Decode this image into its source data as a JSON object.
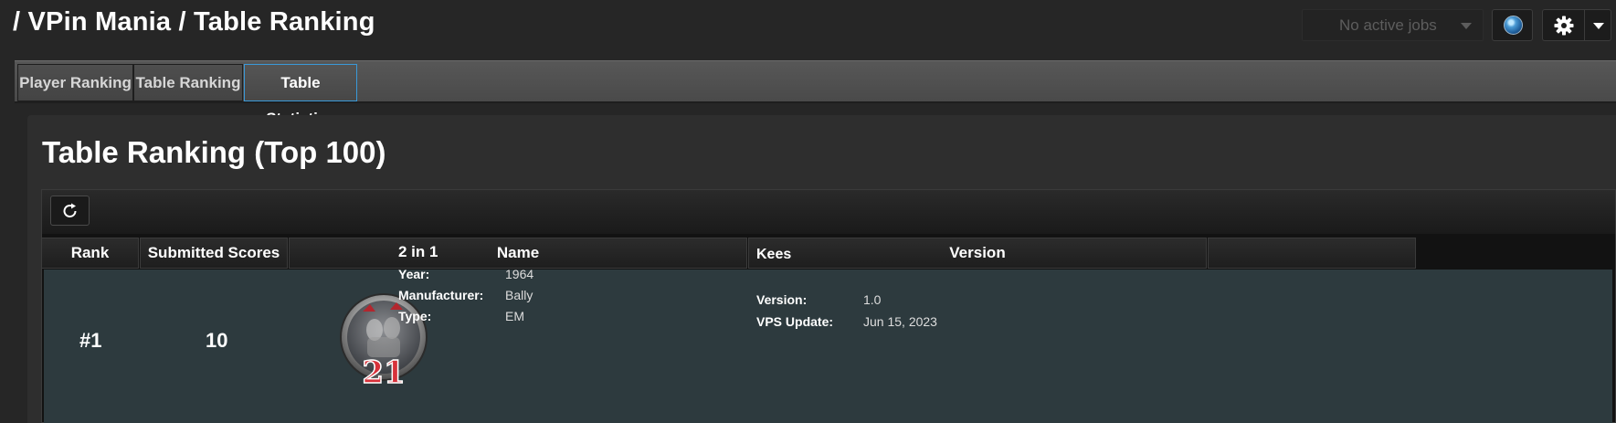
{
  "header": {
    "breadcrumb": "/ VPin Mania / Table Ranking",
    "jobs_label": "No active jobs",
    "globe_icon": "globe-icon",
    "settings_icon": "gear-icon"
  },
  "tabs": [
    {
      "label": "Player Ranking",
      "active": false
    },
    {
      "label": "Table Ranking",
      "active": false
    },
    {
      "label": "Table Statistics",
      "active": true
    }
  ],
  "panel": {
    "title": "Table Ranking (Top 100)",
    "refresh_icon": "refresh-icon"
  },
  "table": {
    "columns": [
      "Rank",
      "Submitted Scores",
      "Name",
      "Version",
      ""
    ],
    "rows": [
      {
        "rank": "#1",
        "submitted_scores": "10",
        "name": "2 in 1",
        "wheel_text": "21",
        "details": {
          "year_label": "Year:",
          "year": "1964",
          "manufacturer_label": "Manufacturer:",
          "manufacturer": "Bally",
          "type_label": "Type:",
          "type": "EM"
        },
        "version_author": "Kees",
        "version_label": "Version:",
        "version": "1.0",
        "vps_update_label": "VPS Update:",
        "vps_update": "Jun 15, 2023"
      }
    ]
  },
  "colors": {
    "accent": "#3a99d8",
    "row_bg": "#2d3a3e",
    "background": "#262626"
  }
}
